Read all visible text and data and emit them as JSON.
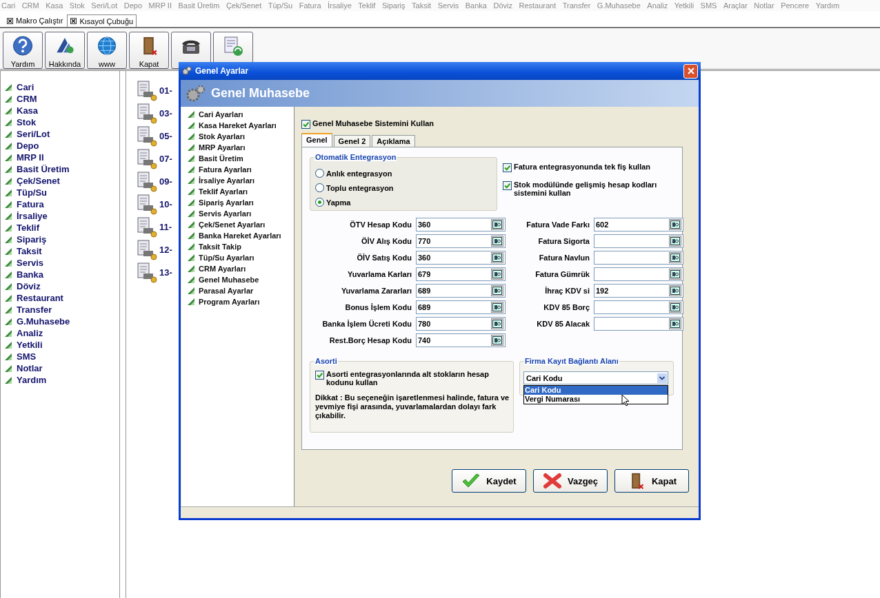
{
  "menu_bar": [
    "Cari",
    "CRM",
    "Kasa",
    "Stok",
    "Seri/Lot",
    "Depo",
    "MRP II",
    "Basit Üretim",
    "Çek/Senet",
    "Tüp/Su",
    "Fatura",
    "İrsaliye",
    "Teklif",
    "Sipariş",
    "Taksit",
    "Servis",
    "Banka",
    "Döviz",
    "Restaurant",
    "Transfer",
    "G.Muhasebe",
    "Analiz",
    "Yetkili",
    "SMS",
    "Araçlar",
    "Notlar",
    "Pencere",
    "Yardım"
  ],
  "doc_tabs": [
    {
      "label": "Makro Çalıştır",
      "selected": false
    },
    {
      "label": "Kısayol Çubuğu",
      "selected": true
    }
  ],
  "toolbar": [
    {
      "kind": "help",
      "label": "Yardım"
    },
    {
      "kind": "logo",
      "label": "Hakkında"
    },
    {
      "kind": "globe",
      "label": "www"
    },
    {
      "kind": "door",
      "label": "Kapat"
    },
    {
      "kind": "phone"
    },
    {
      "kind": "document"
    }
  ],
  "sidebar": {
    "items": [
      "Cari",
      "CRM",
      "Kasa",
      "Stok",
      "Seri/Lot",
      "Depo",
      "MRP II",
      "Basit Üretim",
      "Çek/Senet",
      "Tüp/Su",
      "Fatura",
      "İrsaliye",
      "Teklif",
      "Sipariş",
      "Taksit",
      "Servis",
      "Banka",
      "Döviz",
      "Restaurant",
      "Transfer",
      "G.Muhasebe",
      "Analiz",
      "Yetkili",
      "SMS",
      "Notlar",
      "Yardım"
    ]
  },
  "content_list": [
    "01-",
    "03-",
    "05-",
    "07-",
    "09-",
    "10-",
    "11-",
    "12-",
    "13-"
  ],
  "dialog": {
    "title": "Genel Ayarlar",
    "header": "Genel Muhasebe",
    "nav_items": [
      "Cari Ayarları",
      "Kasa Hareket Ayarları",
      "Stok Ayarları",
      "MRP Ayarları",
      "Basit Üretim",
      "Fatura Ayarları",
      "İrsaliye Ayarları",
      "Teklif Ayarları",
      "Sipariş Ayarları",
      "Servis Ayarları",
      "Çek/Senet Ayarları",
      "Banka Hareket Ayarları",
      "Taksit Takip",
      "Tüp/Su Ayarları",
      "CRM Ayarları",
      "Genel Muhasebe",
      "Parasal Ayarlar",
      "Program Ayarları"
    ],
    "use_system": {
      "label": "Genel Muhasebe Sistemini Kullan",
      "checked": true
    },
    "tabs": [
      {
        "label": "Genel",
        "selected": true
      },
      {
        "label": "Genel 2",
        "selected": false
      },
      {
        "label": "Açıklama",
        "selected": false
      }
    ],
    "integration": {
      "title": "Otomatik Entegrasyon",
      "options": [
        {
          "label": "Anlık entegrasyon",
          "selected": false
        },
        {
          "label": "Toplu entegrasyon",
          "selected": false
        },
        {
          "label": "Yapma",
          "selected": true
        }
      ]
    },
    "options": [
      {
        "label": "Fatura entegrasyonunda tek fiş kullan",
        "checked": true
      },
      {
        "label": "Stok modülünde gelişmiş hesap kodları sistemini kullan",
        "checked": true
      }
    ],
    "left_fields": [
      {
        "label": "ÖTV Hesap Kodu",
        "value": "360"
      },
      {
        "label": "ÖİV Alış Kodu",
        "value": "770"
      },
      {
        "label": "ÖİV Satış Kodu",
        "value": "360"
      },
      {
        "label": "Yuvarlama Karları",
        "value": "679"
      },
      {
        "label": "Yuvarlama Zararları",
        "value": "689"
      },
      {
        "label": "Bonus İşlem Kodu",
        "value": "689"
      },
      {
        "label": "Banka İşlem Ücreti Kodu",
        "value": "780"
      },
      {
        "label": "Rest.Borç Hesap Kodu",
        "value": "740"
      }
    ],
    "right_fields": [
      {
        "label": "Fatura Vade Farkı",
        "value": "602"
      },
      {
        "label": "Fatura Sigorta"
      },
      {
        "label": "Fatura Navlun"
      },
      {
        "label": "Fatura Gümrük"
      },
      {
        "label": "İhraç KDV si",
        "value": "192"
      },
      {
        "label": "KDV 85 Borç"
      },
      {
        "label": "KDV 85 Alacak"
      }
    ],
    "asorti": {
      "title": "Asorti",
      "checkbox": {
        "label": "Asorti entegrasyonlarında alt stokların hesap kodunu kullan",
        "checked": true
      },
      "note": "Dikkat : Bu seçeneğin işaretlenmesi halinde, fatura ve yevmiye fişi arasında, yuvarlamalardan dolayı fark çıkabilir."
    },
    "firma": {
      "title": "Firma Kayıt Bağlantı Alanı",
      "value": "Cari Kodu",
      "options": [
        {
          "label": "Cari Kodu",
          "selected": true
        },
        {
          "label": "Vergi Numarası",
          "selected": false
        }
      ]
    },
    "buttons": [
      {
        "kind": "save",
        "label": "Kaydet"
      },
      {
        "kind": "cancel",
        "label": "Vazgeç"
      },
      {
        "kind": "close",
        "label": "Kapat"
      }
    ]
  }
}
